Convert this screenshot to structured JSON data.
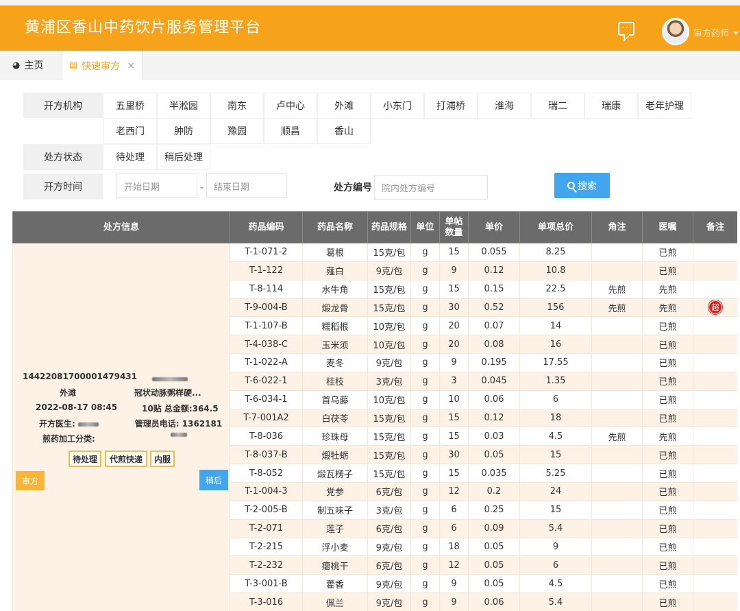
{
  "header": {
    "title": "黄浦区香山中药饮片服务管理平台",
    "user_name": "审方药师",
    "message_icon": "message-icon",
    "accent": "#f7a21b"
  },
  "tabs": [
    {
      "label": "主页",
      "icon": "dashboard-icon"
    },
    {
      "label": "快速审方",
      "icon": "document-icon",
      "close": "×"
    }
  ],
  "filters": {
    "org_label": "开方机构",
    "orgs": [
      "五里桥",
      "半淞园",
      "南东",
      "卢中心",
      "外滩",
      "小东门",
      "打浦桥",
      "淮海",
      "瑞二",
      "瑞康",
      "老年护理",
      "老西门",
      "肿防",
      "豫园",
      "顺昌",
      "香山"
    ],
    "status_label": "处方状态",
    "statuses": [
      "待处理",
      "稍后处理"
    ],
    "time_label": "开方时间",
    "start_placeholder": "开始日期",
    "dash": "-",
    "end_placeholder": "结束日期",
    "rx_label": "处方编号",
    "rx_placeholder": "院内处方编号",
    "search_label": "搜索"
  },
  "table": {
    "columns": [
      "处方信息",
      "药品编码",
      "药品名称",
      "药品规格",
      "单位",
      "单帖\n数量",
      "单价",
      "单项总价",
      "角注",
      "医嘱",
      "备注"
    ],
    "prescription": {
      "id": "14422081700001479431",
      "org": "外滩",
      "diagnosis": "冠状动脉粥样硬...",
      "datetime": "2022-08-17 08:45",
      "summary": "10贴 总金额:364.5",
      "doctor_label": "开方医生:",
      "phone_label": "管理员电话: 1362181",
      "category_label": "煎药加工分类:",
      "tags": [
        "待处理",
        "代煎快递",
        "内服"
      ],
      "approve_label": "审方",
      "later_label": "稍后"
    },
    "rows": [
      [
        "T-1-071-2",
        "葛根",
        "15克/包",
        "g",
        "15",
        "0.055",
        "8.25",
        "",
        "已煎",
        ""
      ],
      [
        "T-1-122",
        "薤白",
        "9克/包",
        "g",
        "9",
        "0.12",
        "10.8",
        "",
        "已煎",
        ""
      ],
      [
        "T-8-114",
        "水牛角",
        "15克/包",
        "g",
        "15",
        "0.15",
        "22.5",
        "先煎",
        "先煎",
        ""
      ],
      [
        "T-9-004-B",
        "煅龙骨",
        "15克/包",
        "g",
        "30",
        "0.52",
        "156",
        "先煎",
        "先煎",
        "超"
      ],
      [
        "T-1-107-B",
        "糯稻根",
        "10克/包",
        "g",
        "20",
        "0.07",
        "14",
        "",
        "已煎",
        ""
      ],
      [
        "T-4-038-C",
        "玉米须",
        "10克/包",
        "g",
        "20",
        "0.08",
        "16",
        "",
        "已煎",
        ""
      ],
      [
        "T-1-022-A",
        "麦冬",
        "9克/包",
        "g",
        "9",
        "0.195",
        "17.55",
        "",
        "已煎",
        ""
      ],
      [
        "T-6-022-1",
        "桂枝",
        "3克/包",
        "g",
        "3",
        "0.045",
        "1.35",
        "",
        "已煎",
        ""
      ],
      [
        "T-6-034-1",
        "首乌藤",
        "10克/包",
        "g",
        "10",
        "0.06",
        "6",
        "",
        "已煎",
        ""
      ],
      [
        "T-7-001A2",
        "白茯苓",
        "15克/包",
        "g",
        "15",
        "0.12",
        "18",
        "",
        "已煎",
        ""
      ],
      [
        "T-8-036",
        "珍珠母",
        "15克/包",
        "g",
        "15",
        "0.03",
        "4.5",
        "先煎",
        "先煎",
        ""
      ],
      [
        "T-8-037-B",
        "煅牡蛎",
        "15克/包",
        "g",
        "30",
        "0.05",
        "15",
        "",
        "已煎",
        ""
      ],
      [
        "T-8-052",
        "煅瓦楞子",
        "15克/包",
        "g",
        "15",
        "0.035",
        "5.25",
        "",
        "已煎",
        ""
      ],
      [
        "T-1-004-3",
        "党参",
        "6克/包",
        "g",
        "12",
        "0.2",
        "24",
        "",
        "已煎",
        ""
      ],
      [
        "T-2-005-B",
        "制五味子",
        "3克/包",
        "g",
        "6",
        "0.25",
        "15",
        "",
        "已煎",
        ""
      ],
      [
        "T-2-071",
        "莲子",
        "6克/包",
        "g",
        "6",
        "0.09",
        "5.4",
        "",
        "已煎",
        ""
      ],
      [
        "T-2-215",
        "浮小麦",
        "9克/包",
        "g",
        "18",
        "0.05",
        "9",
        "",
        "已煎",
        ""
      ],
      [
        "T-2-232",
        "瘪桃干",
        "6克/包",
        "g",
        "12",
        "0.05",
        "6",
        "",
        "已煎",
        ""
      ],
      [
        "T-3-001-B",
        "藿香",
        "9克/包",
        "g",
        "9",
        "0.05",
        "4.5",
        "",
        "已煎",
        ""
      ],
      [
        "T-3-016",
        "佩兰",
        "9克/包",
        "g",
        "9",
        "0.06",
        "5.4",
        "",
        "已煎",
        ""
      ]
    ]
  }
}
